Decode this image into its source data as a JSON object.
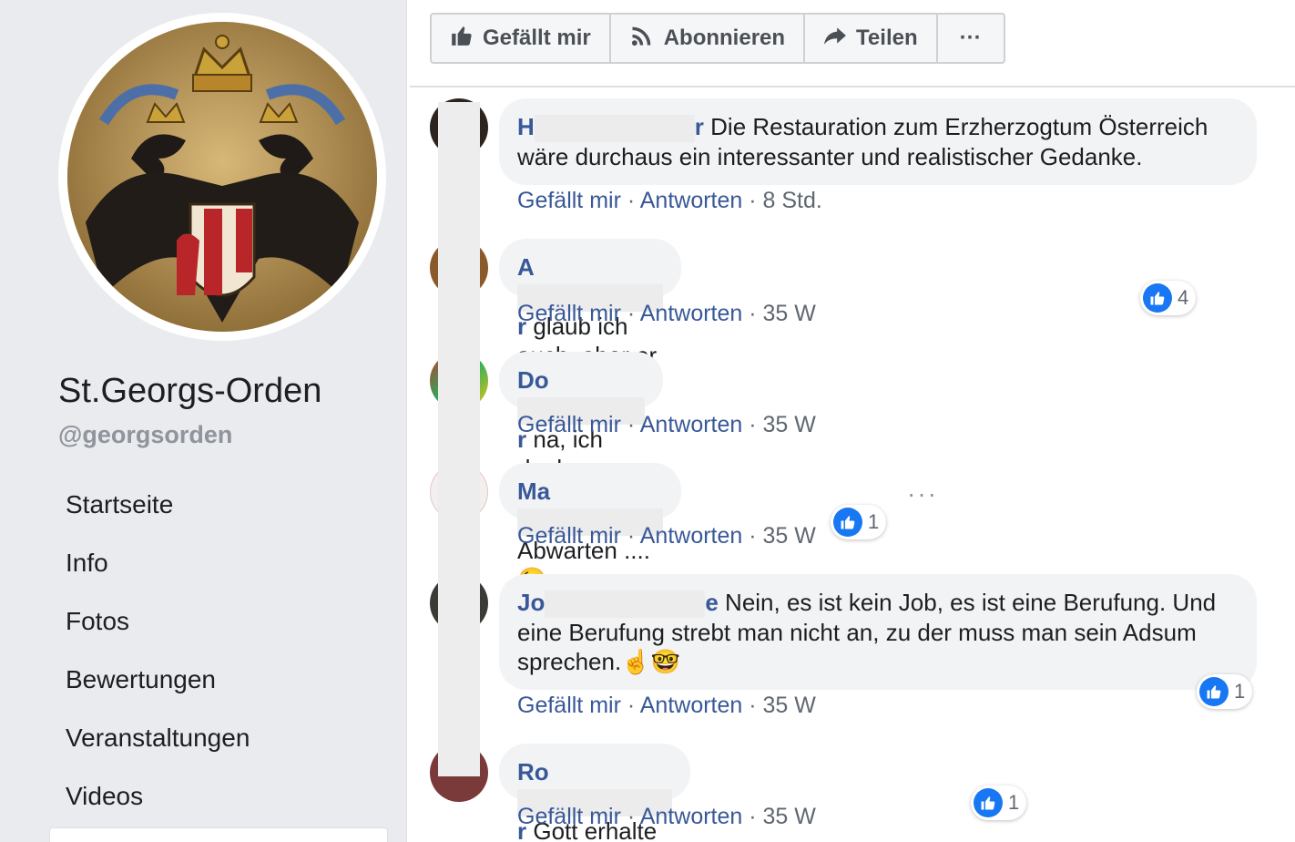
{
  "page": {
    "name": "St.Georgs-Orden",
    "handle": "@georgsorden"
  },
  "nav": {
    "items": [
      "Startseite",
      "Info",
      "Fotos",
      "Bewertungen",
      "Veranstaltungen",
      "Videos"
    ]
  },
  "actions": {
    "like": "Gefällt mir",
    "subscribe": "Abonnieren",
    "share": "Teilen",
    "more": "···"
  },
  "comment_actions": {
    "like": "Gefällt mir",
    "reply": "Antworten",
    "sep": " · "
  },
  "comments": [
    {
      "author_initial": "H",
      "author_tail": "r",
      "text": "Die Restauration zum Erzherzogtum Österreich wäre durchaus ein interessanter und realistischer Gedanke.",
      "time": "8 Std."
    },
    {
      "author_initial": "A",
      "author_tail": "r",
      "text": "glaub ich auch, aber er schafft das schon✨",
      "time": "35 W",
      "likes": "4"
    },
    {
      "author_initial": "Do",
      "author_tail": "r",
      "text": "na, ich denke schon ....",
      "time": "35 W"
    },
    {
      "author_initial": "Ma",
      "author_tail": "",
      "text": "Abwarten .... 😉",
      "time": "35 W",
      "likes": "1"
    },
    {
      "author_initial": "Jo",
      "author_tail": "e",
      "text": "Nein, es ist kein Job, es ist eine Berufung. Und eine Berufung strebt man nicht an, zu der muss man sein Adsum sprechen.☝️🤓",
      "time": "35 W",
      "likes": "1"
    },
    {
      "author_initial": "Ro",
      "author_tail": "r",
      "text": "Gott erhalte unsern Kaiser!",
      "time": "35 W",
      "likes": "1"
    }
  ],
  "colors": {
    "link": "#385898",
    "like_blue": "#1877f2",
    "sidebar_bg": "#e9ebee",
    "bubble_bg": "#f2f3f5"
  }
}
